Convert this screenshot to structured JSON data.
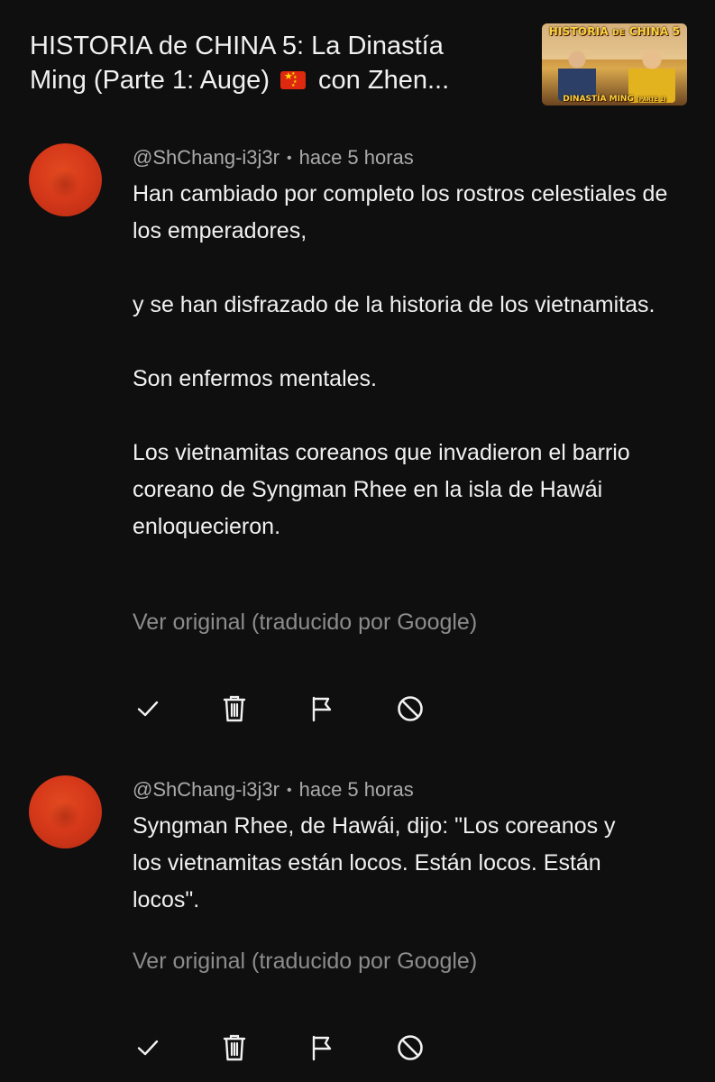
{
  "video": {
    "title_line1": "HISTORIA de CHINA 5: La Dinastía",
    "title_line2_pre": "Ming (Parte 1: Auge)",
    "title_line2_post": "con Zhen...",
    "flag_icon": "china-flag-icon",
    "thumbnail": {
      "title_main": "HISTORIA",
      "title_de": "DE",
      "title_end": "CHINA 5",
      "subtitle_main": "DINASTÍA MING",
      "subtitle_small": "(PARTE 1)"
    }
  },
  "comments": [
    {
      "author": "@ShChang-i3j3r",
      "separator": "•",
      "time": "hace 5 horas",
      "paragraphs": [
        "Han cambiado por completo los rostros celestiales de los emperadores,",
        "y se han disfrazado de la historia de los vietnamitas.",
        "Son enfermos mentales.",
        "Los vietnamitas coreanos que invadieron el barrio coreano de Syngman Rhee en la isla de Hawái enloquecieron."
      ],
      "translate_label": "Ver original (traducido por Google)"
    },
    {
      "author": "@ShChang-i3j3r",
      "separator": "•",
      "time": "hace 5 horas",
      "paragraphs": [
        "Syngman Rhee, de Hawái, dijo: \"Los coreanos y los vietnamitas están locos. Están locos. Están locos\"."
      ],
      "translate_label": "Ver original (traducido por Google)"
    }
  ],
  "actions": [
    {
      "name": "approve",
      "icon": "checkmark-icon"
    },
    {
      "name": "delete",
      "icon": "trash-icon"
    },
    {
      "name": "report",
      "icon": "flag-icon"
    },
    {
      "name": "block",
      "icon": "block-icon"
    }
  ],
  "colors": {
    "background": "#0f0f0f",
    "primary_text": "#f1f1f1",
    "secondary_text": "#aaaaaa",
    "link_text": "#8c8c8c",
    "avatar": "#d6391a"
  }
}
